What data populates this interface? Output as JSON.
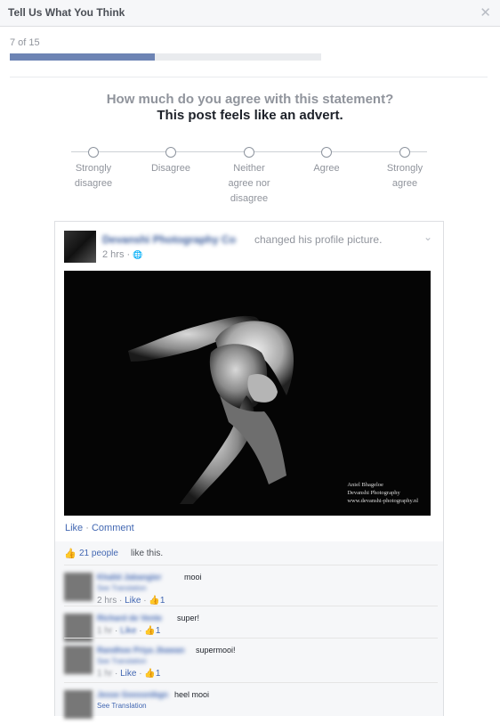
{
  "dialog": {
    "title": "Tell Us What You Think",
    "close_icon": "✕"
  },
  "progress": {
    "text": "7 of 15",
    "current": 7,
    "total": 15,
    "fraction": 0.467
  },
  "survey": {
    "question": "How much do you agree with this statement?",
    "statement": "This post feels like an advert.",
    "options": [
      {
        "lines": [
          "Strongly",
          "disagree"
        ]
      },
      {
        "lines": [
          "Disagree"
        ]
      },
      {
        "lines": [
          "Neither",
          "agree nor",
          "disagree"
        ]
      },
      {
        "lines": [
          "Agree"
        ]
      },
      {
        "lines": [
          "Strongly",
          "agree"
        ]
      }
    ]
  },
  "post": {
    "author": "Devanshi Photography Co",
    "action": "changed his profile picture.",
    "time": "2 hrs ·",
    "globe_icon": "🌐",
    "chevron_icon": "⌄",
    "photo_credit": [
      "Aniel Bhageloe",
      "Devanshi Photography",
      "www.devanshi-photography.nl"
    ],
    "like_label": "Like",
    "separator": " · ",
    "comment_label": "Comment"
  },
  "likes": {
    "thumb_icon": "👍",
    "count_text": "21 people",
    "suffix": "like this."
  },
  "comments": [
    {
      "name": "Khalid Jabangier",
      "text": "mooi",
      "translation": "See Translation",
      "time": "2 hrs",
      "like": "Like",
      "likes": "1"
    },
    {
      "name": "Richard de Vente",
      "text": "super!",
      "translation": "",
      "time": "1 hr",
      "like": "Like",
      "likes": "1"
    },
    {
      "name": "Randhoe Priya Jbawan",
      "text": "supermooi!",
      "translation": "See Translation",
      "time": "1 hr",
      "like": "Like",
      "likes": "1"
    },
    {
      "name": "Jesse Goossnibgn",
      "text": "heel mooi",
      "translation": "See Translation",
      "time": "",
      "like": "",
      "likes": ""
    }
  ],
  "colors": {
    "accent": "#6d84b4",
    "link": "#4267b2",
    "muted": "#90949c"
  }
}
